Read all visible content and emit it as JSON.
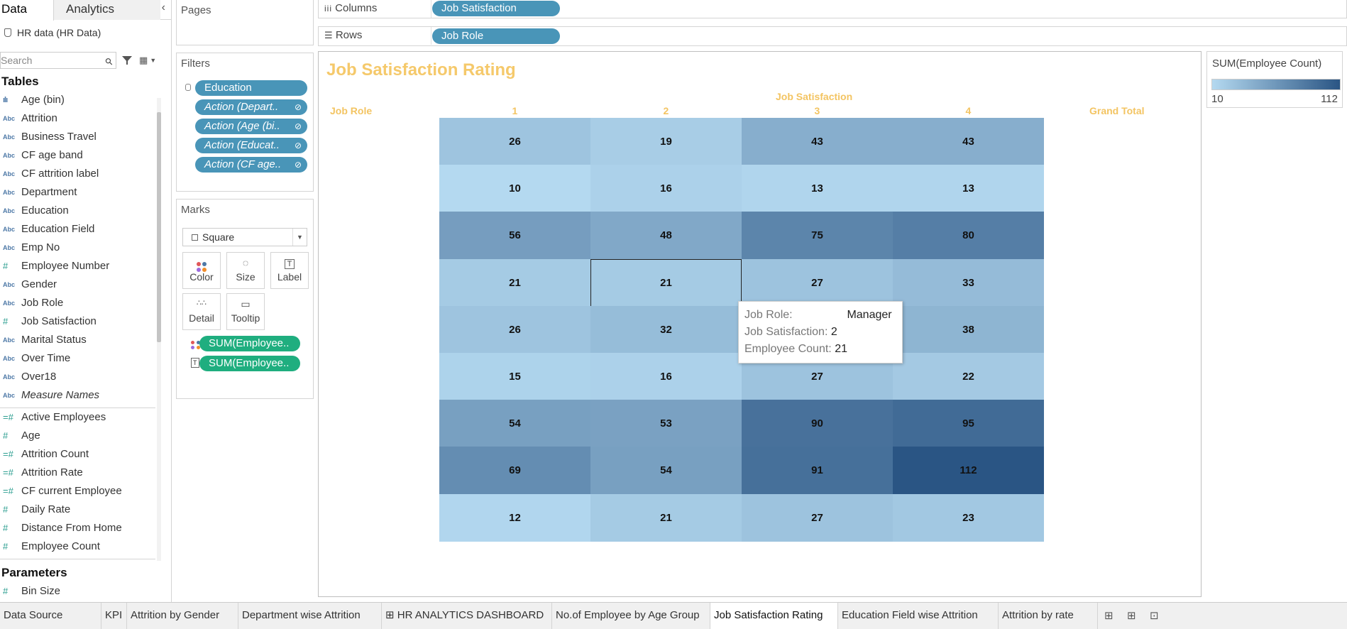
{
  "left_pane": {
    "tabs": [
      "Data",
      "Analytics"
    ],
    "collapse_glyph": "‹",
    "datasource": "HR data (HR Data)",
    "search_placeholder": "Search",
    "tables_title": "Tables",
    "dimensions": [
      {
        "icon": "bins",
        "name": "Age (bin)"
      },
      {
        "icon": "abc",
        "name": "Attrition"
      },
      {
        "icon": "abc",
        "name": "Business Travel"
      },
      {
        "icon": "abc",
        "name": "CF age band"
      },
      {
        "icon": "abc",
        "name": "CF attrition label"
      },
      {
        "icon": "abc",
        "name": "Department"
      },
      {
        "icon": "abc",
        "name": "Education"
      },
      {
        "icon": "abc",
        "name": "Education Field"
      },
      {
        "icon": "abc",
        "name": "Emp No"
      },
      {
        "icon": "hash",
        "name": "Employee Number"
      },
      {
        "icon": "abc",
        "name": "Gender"
      },
      {
        "icon": "abc",
        "name": "Job Role"
      },
      {
        "icon": "hash",
        "name": "Job Satisfaction"
      },
      {
        "icon": "abc",
        "name": "Marital Status"
      },
      {
        "icon": "abc",
        "name": "Over Time"
      },
      {
        "icon": "abc",
        "name": "Over18"
      },
      {
        "icon": "abc",
        "name": "Measure Names",
        "italic": true
      }
    ],
    "measures": [
      {
        "icon": "calc-hash",
        "name": "Active Employees"
      },
      {
        "icon": "hash",
        "name": "Age"
      },
      {
        "icon": "calc-hash",
        "name": "Attrition Count"
      },
      {
        "icon": "calc-hash",
        "name": "Attrition Rate"
      },
      {
        "icon": "calc-hash",
        "name": "CF current Employee"
      },
      {
        "icon": "hash",
        "name": "Daily Rate"
      },
      {
        "icon": "hash",
        "name": "Distance From Home"
      },
      {
        "icon": "hash",
        "name": "Employee Count"
      }
    ],
    "parameters_title": "Parameters",
    "parameters": [
      {
        "icon": "hash",
        "name": "Bin Size"
      }
    ]
  },
  "pages": {
    "title": "Pages"
  },
  "filters": {
    "title": "Filters",
    "pills": [
      {
        "label": "Education",
        "italic": false,
        "link": false
      },
      {
        "label": "Action (Depart..",
        "italic": true,
        "link": true
      },
      {
        "label": "Action (Age (bi..",
        "italic": true,
        "link": true
      },
      {
        "label": "Action (Educat..",
        "italic": true,
        "link": true
      },
      {
        "label": "Action (CF age..",
        "italic": true,
        "link": true
      }
    ]
  },
  "marks": {
    "title": "Marks",
    "mark_type": "Square",
    "buttons": [
      "Color",
      "Size",
      "Label",
      "Detail",
      "Tooltip"
    ],
    "fields": [
      {
        "icon": "color-dots",
        "label": "SUM(Employee.."
      },
      {
        "icon": "label-box",
        "label": "SUM(Employee.."
      }
    ]
  },
  "shelves": {
    "columns_label": "Columns",
    "columns_pill": "Job Satisfaction",
    "rows_label": "Rows",
    "rows_pill": "Job Role"
  },
  "view": {
    "title": "Job Satisfaction Rating",
    "column_header": "Job Satisfaction",
    "row_header": "Job Role",
    "grand_total": "Grand Total",
    "columns": [
      "1",
      "2",
      "3",
      "4"
    ],
    "matrix": [
      [
        26,
        19,
        43,
        43
      ],
      [
        10,
        16,
        13,
        13
      ],
      [
        56,
        48,
        75,
        80
      ],
      [
        21,
        21,
        27,
        33
      ],
      [
        26,
        32,
        null,
        38
      ],
      [
        15,
        16,
        27,
        22
      ],
      [
        54,
        53,
        90,
        95
      ],
      [
        69,
        54,
        91,
        112
      ],
      [
        12,
        21,
        27,
        23
      ]
    ],
    "color_min": 10,
    "color_max": 112,
    "color_low": "#b4d9f0",
    "color_high": "#2a5584",
    "title_color": "#f5c96b",
    "header_color": "#f3c462"
  },
  "tooltip": {
    "rows": [
      {
        "key": "Job Role:",
        "value": "Manager"
      },
      {
        "key": "Job Satisfaction:",
        "value": "2"
      },
      {
        "key": "Employee Count:",
        "value": "21"
      }
    ]
  },
  "legend": {
    "title": "SUM(Employee Count)",
    "min_label": "10",
    "max_label": "112"
  },
  "tabs": [
    {
      "label": "Data Source"
    },
    {
      "label": "KPI"
    },
    {
      "label": "Attrition by Gender"
    },
    {
      "label": "Department wise Attrition"
    },
    {
      "label": "HR ANALYTICS DASHBOARD",
      "icon": "dashboard"
    },
    {
      "label": "No.of Employee by Age Group"
    },
    {
      "label": "Job Satisfaction Rating",
      "active": true
    },
    {
      "label": "Education Field wise Attrition"
    },
    {
      "label": "Attrition by rate"
    }
  ]
}
